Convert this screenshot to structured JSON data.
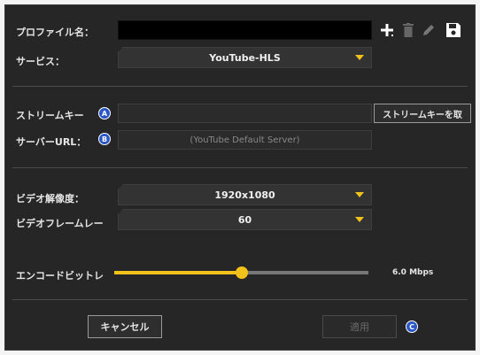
{
  "profile": {
    "label": "プロファイル名：",
    "value": ""
  },
  "service": {
    "label": "サービス：",
    "selected": "YouTube-HLS"
  },
  "stream_key": {
    "label": "ストリームキー",
    "badge": "A",
    "value": "",
    "button_label": "ストリームキーを取"
  },
  "server_url": {
    "label": "サーバーURL：",
    "badge": "B",
    "placeholder": "(YouTube Default Server)"
  },
  "video_resolution": {
    "label": "ビデオ解像度：",
    "selected": "1920x1080"
  },
  "video_framerate": {
    "label": "ビデオフレームレー",
    "selected": "60"
  },
  "encode_bitrate": {
    "label": "エンコードビットレ",
    "value_text": "6.0 Mbps",
    "fill": 0.5
  },
  "footer": {
    "cancel_label": "キャンセル",
    "apply_label": "適用",
    "badge": "C"
  },
  "colors": {
    "accent": "#f2c21b",
    "badge": "#2a56c6",
    "panel": "#262626"
  }
}
